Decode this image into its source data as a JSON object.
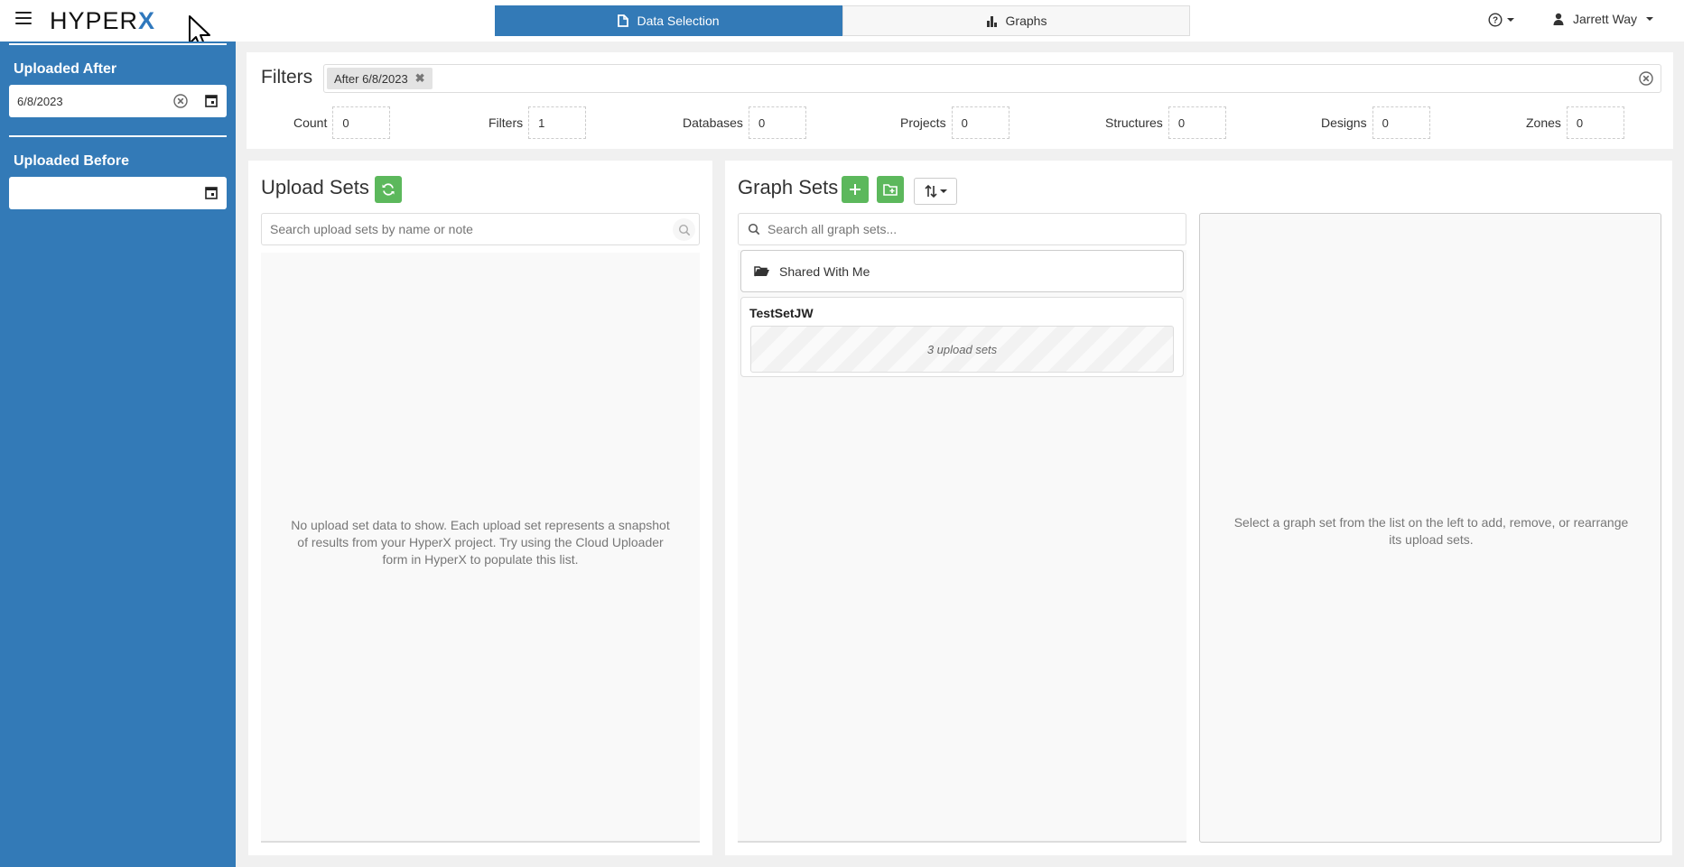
{
  "header": {
    "logo_text": "HYPER",
    "logo_accent": "X",
    "tabs": [
      {
        "label": "Data Selection",
        "icon": "document-icon",
        "active": true
      },
      {
        "label": "Graphs",
        "icon": "bar-chart-icon",
        "active": false
      }
    ],
    "help_icon": "question-circle-icon",
    "user_name": "Jarrett Way"
  },
  "sidebar": {
    "uploaded_after": {
      "label": "Uploaded After",
      "value": "6/8/2023"
    },
    "uploaded_before": {
      "label": "Uploaded Before",
      "value": ""
    }
  },
  "filters": {
    "title": "Filters",
    "chips": [
      {
        "label": "After 6/8/2023"
      }
    ],
    "stats": [
      {
        "label": "Count",
        "value": "0"
      },
      {
        "label": "Filters",
        "value": "1"
      },
      {
        "label": "Databases",
        "value": "0"
      },
      {
        "label": "Projects",
        "value": "0"
      },
      {
        "label": "Structures",
        "value": "0"
      },
      {
        "label": "Designs",
        "value": "0"
      },
      {
        "label": "Zones",
        "value": "0"
      }
    ]
  },
  "upload_sets": {
    "title": "Upload Sets",
    "search_placeholder": "Search upload sets by name or note",
    "empty_message": "No upload set data to show. Each upload set represents a snapshot of results from your HyperX project. Try using the Cloud Uploader form in HyperX to populate this list."
  },
  "graph_sets": {
    "title": "Graph Sets",
    "search_placeholder": "Search all graph sets...",
    "shared_folder": "Shared With Me",
    "sets": [
      {
        "name": "TestSetJW",
        "summary": "3 upload sets"
      }
    ],
    "detail_message": "Select a graph set from the list on the left to add, remove, or rearrange its upload sets."
  },
  "colors": {
    "primary": "#337ab7",
    "success": "#5cb85c"
  }
}
